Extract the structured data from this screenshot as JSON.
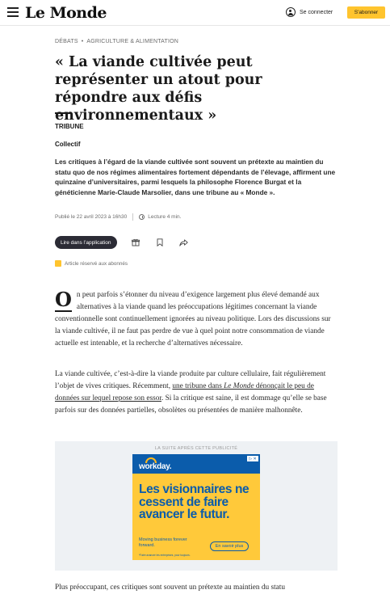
{
  "header": {
    "logo": "Le Monde",
    "login_label": "Se connecter",
    "subscribe_label": "S'abonner"
  },
  "breadcrumb": {
    "section": "Débats",
    "subsection": "Agriculture & alimentation"
  },
  "article": {
    "title": "« La viande cultivée peut représenter un atout pour répondre aux défis environnementaux »",
    "kicker": "Tribune",
    "author": "Collectif",
    "chapo": "Les critiques à l’égard de la viande cultivée sont souvent un prétexte au maintien du statu quo de nos régimes alimentaires fortement dépendants de l’élevage, affirment une quinzaine d’universitaires, parmi lesquels la philosophe Florence Burgat et la généticienne Marie-Claude Marsolier, dans une tribune au « Monde ».",
    "published": "Publié le 22 avril 2023 à 16h30",
    "reading_time": "Lecture 4 min.",
    "app_button": "Lire dans l’application",
    "reserved_note": "Article réservé aux abonnés",
    "p1_dropcap": "O",
    "p1": "n peut parfois s’étonner du niveau d’exigence largement plus élevé demandé aux alternatives à la viande quand les préoccupations légitimes concernant la viande conventionnelle sont continuellement ignorées au niveau politique. Lors des discussions sur la viande cultivée, il ne faut pas perdre de vue à quel point notre consommation de viande actuelle est intenable, et la recherche d’alternatives nécessaire.",
    "p2_before": "La viande cultivée, c’est-à-dire la viande produite par culture cellulaire, fait régulièrement l’objet de vives critiques. Récemment, ",
    "p2_link_a": "une tribune dans ",
    "p2_link_b": "Le Monde",
    "p2_link_c": " dénonçait le peu de données sur lequel repose son essor",
    "p2_after": ". Si la critique est saine, il est dommage qu’elle se base parfois sur des données partielles, obsolètes ou présentées de manière malhonnête.",
    "p3": "Plus préoccupant, ces critiques sont souvent un prétexte au maintien du statu"
  },
  "ad": {
    "label": "LA SUITE APRÈS CETTE PUBLICITÉ",
    "brand": "workday.",
    "headline": "Les visionnaires ne cessent de faire avancer le futur.",
    "tagline": "Moving business forever forward.",
    "fine_print": "*Faire avancer les entreprises, pour toujours.",
    "cta": "En savoir plus",
    "adchoices": "▷ ✕"
  },
  "icons": {
    "menu": "hamburger-menu-icon",
    "user": "user-icon",
    "gift": "gift-icon",
    "bookmark": "bookmark-icon",
    "share": "share-icon",
    "clock": "clock-icon",
    "subscriber": "subscriber-badge-icon"
  },
  "colors": {
    "subscribe": "#ffc42e",
    "app_button": "#2b2b35",
    "ad_background": "#ffc93a",
    "ad_blue": "#0b5cab"
  }
}
